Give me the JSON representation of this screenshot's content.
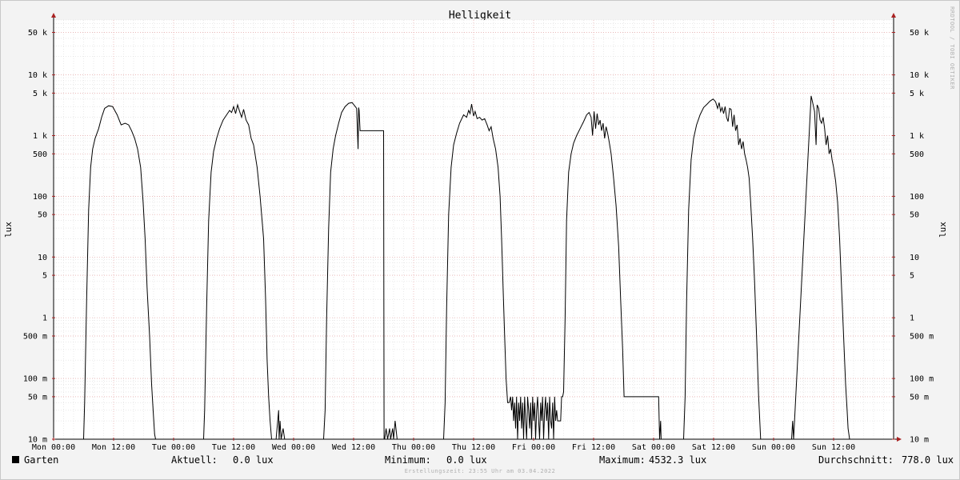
{
  "chart_data": {
    "type": "line",
    "title": "Helligkeit",
    "ylabel": "lux",
    "ylabel_right": "lux",
    "y_scale": "log",
    "ylim": [
      0.01,
      80000
    ],
    "y_ticks": [
      {
        "value": 50000,
        "label": "50 k"
      },
      {
        "value": 10000,
        "label": "10 k"
      },
      {
        "value": 5000,
        "label": "5 k"
      },
      {
        "value": 1000,
        "label": "1 k"
      },
      {
        "value": 500,
        "label": "500"
      },
      {
        "value": 100,
        "label": "100"
      },
      {
        "value": 50,
        "label": "50"
      },
      {
        "value": 10,
        "label": "10"
      },
      {
        "value": 5,
        "label": "5"
      },
      {
        "value": 1,
        "label": "1"
      },
      {
        "value": 0.5,
        "label": "500 m"
      },
      {
        "value": 0.1,
        "label": "100 m"
      },
      {
        "value": 0.05,
        "label": "50 m"
      },
      {
        "value": 0.01,
        "label": "10 m"
      }
    ],
    "x_unit": "hours since Mon 00:00",
    "xlim": [
      0,
      168
    ],
    "x_ticks": [
      {
        "value": 0,
        "label": "Mon 00:00"
      },
      {
        "value": 12,
        "label": "Mon 12:00"
      },
      {
        "value": 24,
        "label": "Tue 00:00"
      },
      {
        "value": 36,
        "label": "Tue 12:00"
      },
      {
        "value": 48,
        "label": "Wed 00:00"
      },
      {
        "value": 60,
        "label": "Wed 12:00"
      },
      {
        "value": 72,
        "label": "Thu 00:00"
      },
      {
        "value": 84,
        "label": "Thu 12:00"
      },
      {
        "value": 96,
        "label": "Fri 00:00"
      },
      {
        "value": 108,
        "label": "Fri 12:00"
      },
      {
        "value": 120,
        "label": "Sat 00:00"
      },
      {
        "value": 132,
        "label": "Sat 12:00"
      },
      {
        "value": 144,
        "label": "Sun 00:00"
      },
      {
        "value": 156,
        "label": "Sun 12:00"
      }
    ],
    "grid": true,
    "series": [
      {
        "name": "Garten",
        "color": "#000000",
        "x": [
          6.0,
          6.2,
          6.6,
          7.0,
          7.4,
          7.8,
          8.3,
          9.0,
          9.6,
          10.2,
          11.0,
          11.8,
          12.7,
          13.5,
          14.3,
          15.0,
          15.6,
          16.2,
          16.8,
          17.4,
          17.9,
          18.3,
          18.7,
          19.2,
          19.6,
          19.9,
          20.2,
          20.4,
          20.7,
          21.0,
          30.0,
          30.2,
          30.6,
          31.0,
          31.5,
          32.0,
          32.6,
          33.2,
          33.9,
          34.6,
          35.2,
          35.6,
          36.0,
          36.4,
          36.8,
          37.2,
          37.6,
          38.0,
          38.5,
          39.0,
          39.5,
          40.0,
          40.7,
          41.3,
          42.0,
          42.4,
          42.7,
          43.0,
          43.3,
          43.6,
          44.0,
          44.2,
          44.5,
          45.0,
          45.1,
          45.3,
          45.5,
          45.9,
          46.2,
          54.0,
          54.3,
          54.6,
          55.0,
          55.4,
          55.9,
          56.4,
          57.0,
          57.6,
          58.3,
          59.0,
          59.7,
          60.2,
          60.6,
          60.9,
          61.0,
          61.1,
          61.3,
          61.6,
          62.0,
          62.4,
          62.8,
          64.0,
          65.0,
          66.0,
          66.1,
          66.2,
          66.5,
          66.8,
          67.2,
          67.4,
          67.8,
          68.0,
          68.3,
          68.7,
          78.0,
          78.3,
          78.6,
          79.0,
          79.5,
          80.0,
          80.6,
          81.2,
          82.0,
          82.6,
          83.0,
          83.3,
          83.6,
          84.0,
          84.3,
          84.7,
          85.2,
          85.7,
          86.2,
          86.7,
          87.1,
          87.5,
          87.9,
          88.4,
          88.9,
          89.3,
          89.6,
          89.9,
          90.2,
          90.5,
          90.8,
          91.1,
          91.4,
          91.6,
          91.8,
          92.0,
          92.2,
          92.4,
          92.6,
          92.8,
          93.0,
          93.2,
          93.4,
          93.6,
          93.8,
          94.0,
          94.2,
          94.4,
          94.6,
          94.8,
          95.0,
          95.2,
          95.4,
          95.6,
          95.8,
          96.0,
          96.2,
          96.4,
          96.6,
          96.8,
          97.0,
          97.2,
          97.4,
          97.6,
          97.8,
          98.0,
          98.2,
          98.4,
          98.6,
          98.8,
          99.0,
          99.2,
          99.4,
          99.6,
          99.8,
          100.0,
          100.2,
          100.4,
          100.6,
          100.8,
          101.0,
          101.2,
          101.4,
          101.6,
          101.8,
          102.0,
          102.3,
          102.6,
          103.0,
          103.5,
          104.0,
          104.6,
          105.3,
          106.0,
          106.6,
          107.1,
          107.5,
          107.8,
          108.1,
          108.4,
          108.7,
          109.0,
          109.3,
          109.6,
          109.9,
          110.2,
          110.5,
          110.8,
          111.1,
          111.5,
          112.0,
          112.5,
          113.0,
          113.4,
          113.8,
          114.1,
          114.4,
          114.7,
          115.0,
          116.8,
          117.0,
          117.2,
          117.4,
          118.0,
          119.0,
          120.0,
          121.0,
          121.2,
          121.4,
          121.5,
          126.0,
          126.3,
          126.6,
          127.0,
          127.5,
          128.0,
          128.6,
          129.3,
          130.0,
          130.7,
          131.3,
          131.9,
          132.4,
          132.8,
          133.1,
          133.4,
          133.7,
          134.0,
          134.3,
          134.6,
          134.9,
          135.2,
          135.5,
          135.8,
          136.1,
          136.4,
          136.7,
          137.0,
          137.3,
          137.6,
          137.9,
          138.2,
          138.5,
          138.8,
          139.1,
          139.4,
          139.8,
          140.2,
          140.6,
          141.0,
          141.4,
          141.7,
          142.0,
          142.3,
          142.6,
          147.6,
          147.8,
          148.0,
          151.5,
          151.8,
          152.2,
          152.5,
          152.7,
          153.0,
          153.3,
          153.6,
          153.9,
          154.2,
          154.5,
          154.8,
          155.1,
          155.4,
          155.7,
          156.0,
          156.4,
          156.8,
          157.2,
          157.6,
          158.0,
          158.4,
          158.7,
          158.9,
          159.2,
          159.4,
          159.8
        ],
        "y": [
          0.01,
          0.04,
          2.0,
          60,
          300,
          600,
          900,
          1300,
          2000,
          2800,
          3100,
          3000,
          2200,
          1500,
          1600,
          1500,
          1200,
          900,
          600,
          300,
          80,
          20,
          3,
          0.5,
          0.08,
          0.03,
          0.012,
          0.01,
          0.01,
          0.01,
          0.01,
          0.03,
          1.5,
          40,
          250,
          550,
          900,
          1300,
          1800,
          2200,
          2600,
          2400,
          3000,
          2300,
          3200,
          2500,
          2000,
          2700,
          1800,
          1500,
          900,
          700,
          300,
          100,
          20,
          2,
          0.2,
          0.05,
          0.02,
          0.01,
          0.01,
          0.01,
          0.01,
          0.03,
          0.01,
          0.02,
          0.01,
          0.015,
          0.01,
          0.01,
          0.03,
          1.0,
          30,
          250,
          600,
          1000,
          1600,
          2400,
          3000,
          3400,
          3500,
          3100,
          2800,
          600,
          2900,
          2600,
          1200,
          1200,
          1200,
          1200,
          1200,
          1200,
          1200,
          1200,
          0.01,
          0.01,
          0.015,
          0.01,
          0.015,
          0.01,
          0.015,
          0.01,
          0.02,
          0.01,
          0.01,
          0.04,
          1.5,
          50,
          300,
          700,
          1100,
          1600,
          2200,
          2000,
          2600,
          2300,
          3300,
          2100,
          2500,
          1900,
          2000,
          1800,
          1900,
          1500,
          1200,
          1400,
          900,
          600,
          300,
          100,
          20,
          3,
          0.5,
          0.1,
          0.04,
          0.04,
          0.05,
          0.03,
          0.05,
          0.02,
          0.04,
          0.015,
          0.05,
          0.01,
          0.04,
          0.02,
          0.05,
          0.015,
          0.04,
          0.01,
          0.05,
          0.02,
          0.01,
          0.05,
          0.03,
          0.015,
          0.04,
          0.01,
          0.05,
          0.02,
          0.04,
          0.01,
          0.03,
          0.05,
          0.02,
          0.01,
          0.04,
          0.02,
          0.05,
          0.01,
          0.03,
          0.05,
          0.02,
          0.04,
          0.01,
          0.05,
          0.02,
          0.015,
          0.04,
          0.01,
          0.05,
          0.02,
          0.03,
          0.02,
          0.02,
          0.02,
          0.02,
          0.05,
          0.05,
          0.06,
          1.0,
          40,
          250,
          500,
          750,
          1000,
          1300,
          1700,
          2200,
          2400,
          2000,
          1000,
          2500,
          1300,
          2300,
          1500,
          1800,
          1200,
          1600,
          900,
          1400,
          1100,
          800,
          500,
          200,
          70,
          15,
          2,
          0.3,
          0.05,
          0.05,
          0.05,
          0.05,
          0.05,
          0.05,
          0.05,
          0.05,
          0.05,
          0.05,
          0.05,
          0.05,
          0.01,
          0.02,
          0.01,
          0.01,
          0.05,
          2.0,
          60,
          400,
          900,
          1500,
          2200,
          2900,
          3300,
          3700,
          4000,
          3600,
          2800,
          3500,
          2500,
          2900,
          2300,
          3000,
          2000,
          1700,
          2800,
          2700,
          1400,
          2200,
          1200,
          1500,
          700,
          900,
          600,
          800,
          500,
          400,
          300,
          200,
          80,
          20,
          4,
          0.5,
          0.05,
          0.01,
          0.01,
          0.01,
          0.01,
          0.01,
          0.01,
          0.02,
          0.01,
          4500,
          3500,
          2500,
          700,
          3200,
          2800,
          1800,
          1600,
          2000,
          1300,
          700,
          1000,
          500,
          600,
          400,
          300,
          180,
          80,
          20,
          3,
          0.5,
          0.08,
          0.03,
          0.015,
          0.01,
          0.01,
          0.01
        ]
      }
    ],
    "legend_position": "bottom-left"
  },
  "legend": {
    "series_label": "Garten",
    "current_label": "Aktuell:",
    "current_value": "0.0 lux",
    "min_label": "Minimum:",
    "min_value": "0.0 lux",
    "max_label": "Maximum:",
    "max_value": "4532.3 lux",
    "avg_label": "Durchschnitt:",
    "avg_value": "778.0 lux"
  },
  "watermark": "RRDTOOL / TOBI OETIKER",
  "created": "Erstellungszeit: 23:55 Uhr am 03.04.2022",
  "colors": {
    "background": "#f3f3f3",
    "plot_bg": "#ffffff",
    "grid_minor": "#e0e0e0",
    "grid_major": "#e8a8a8",
    "line": "#000000",
    "axis": "#aa2222"
  }
}
